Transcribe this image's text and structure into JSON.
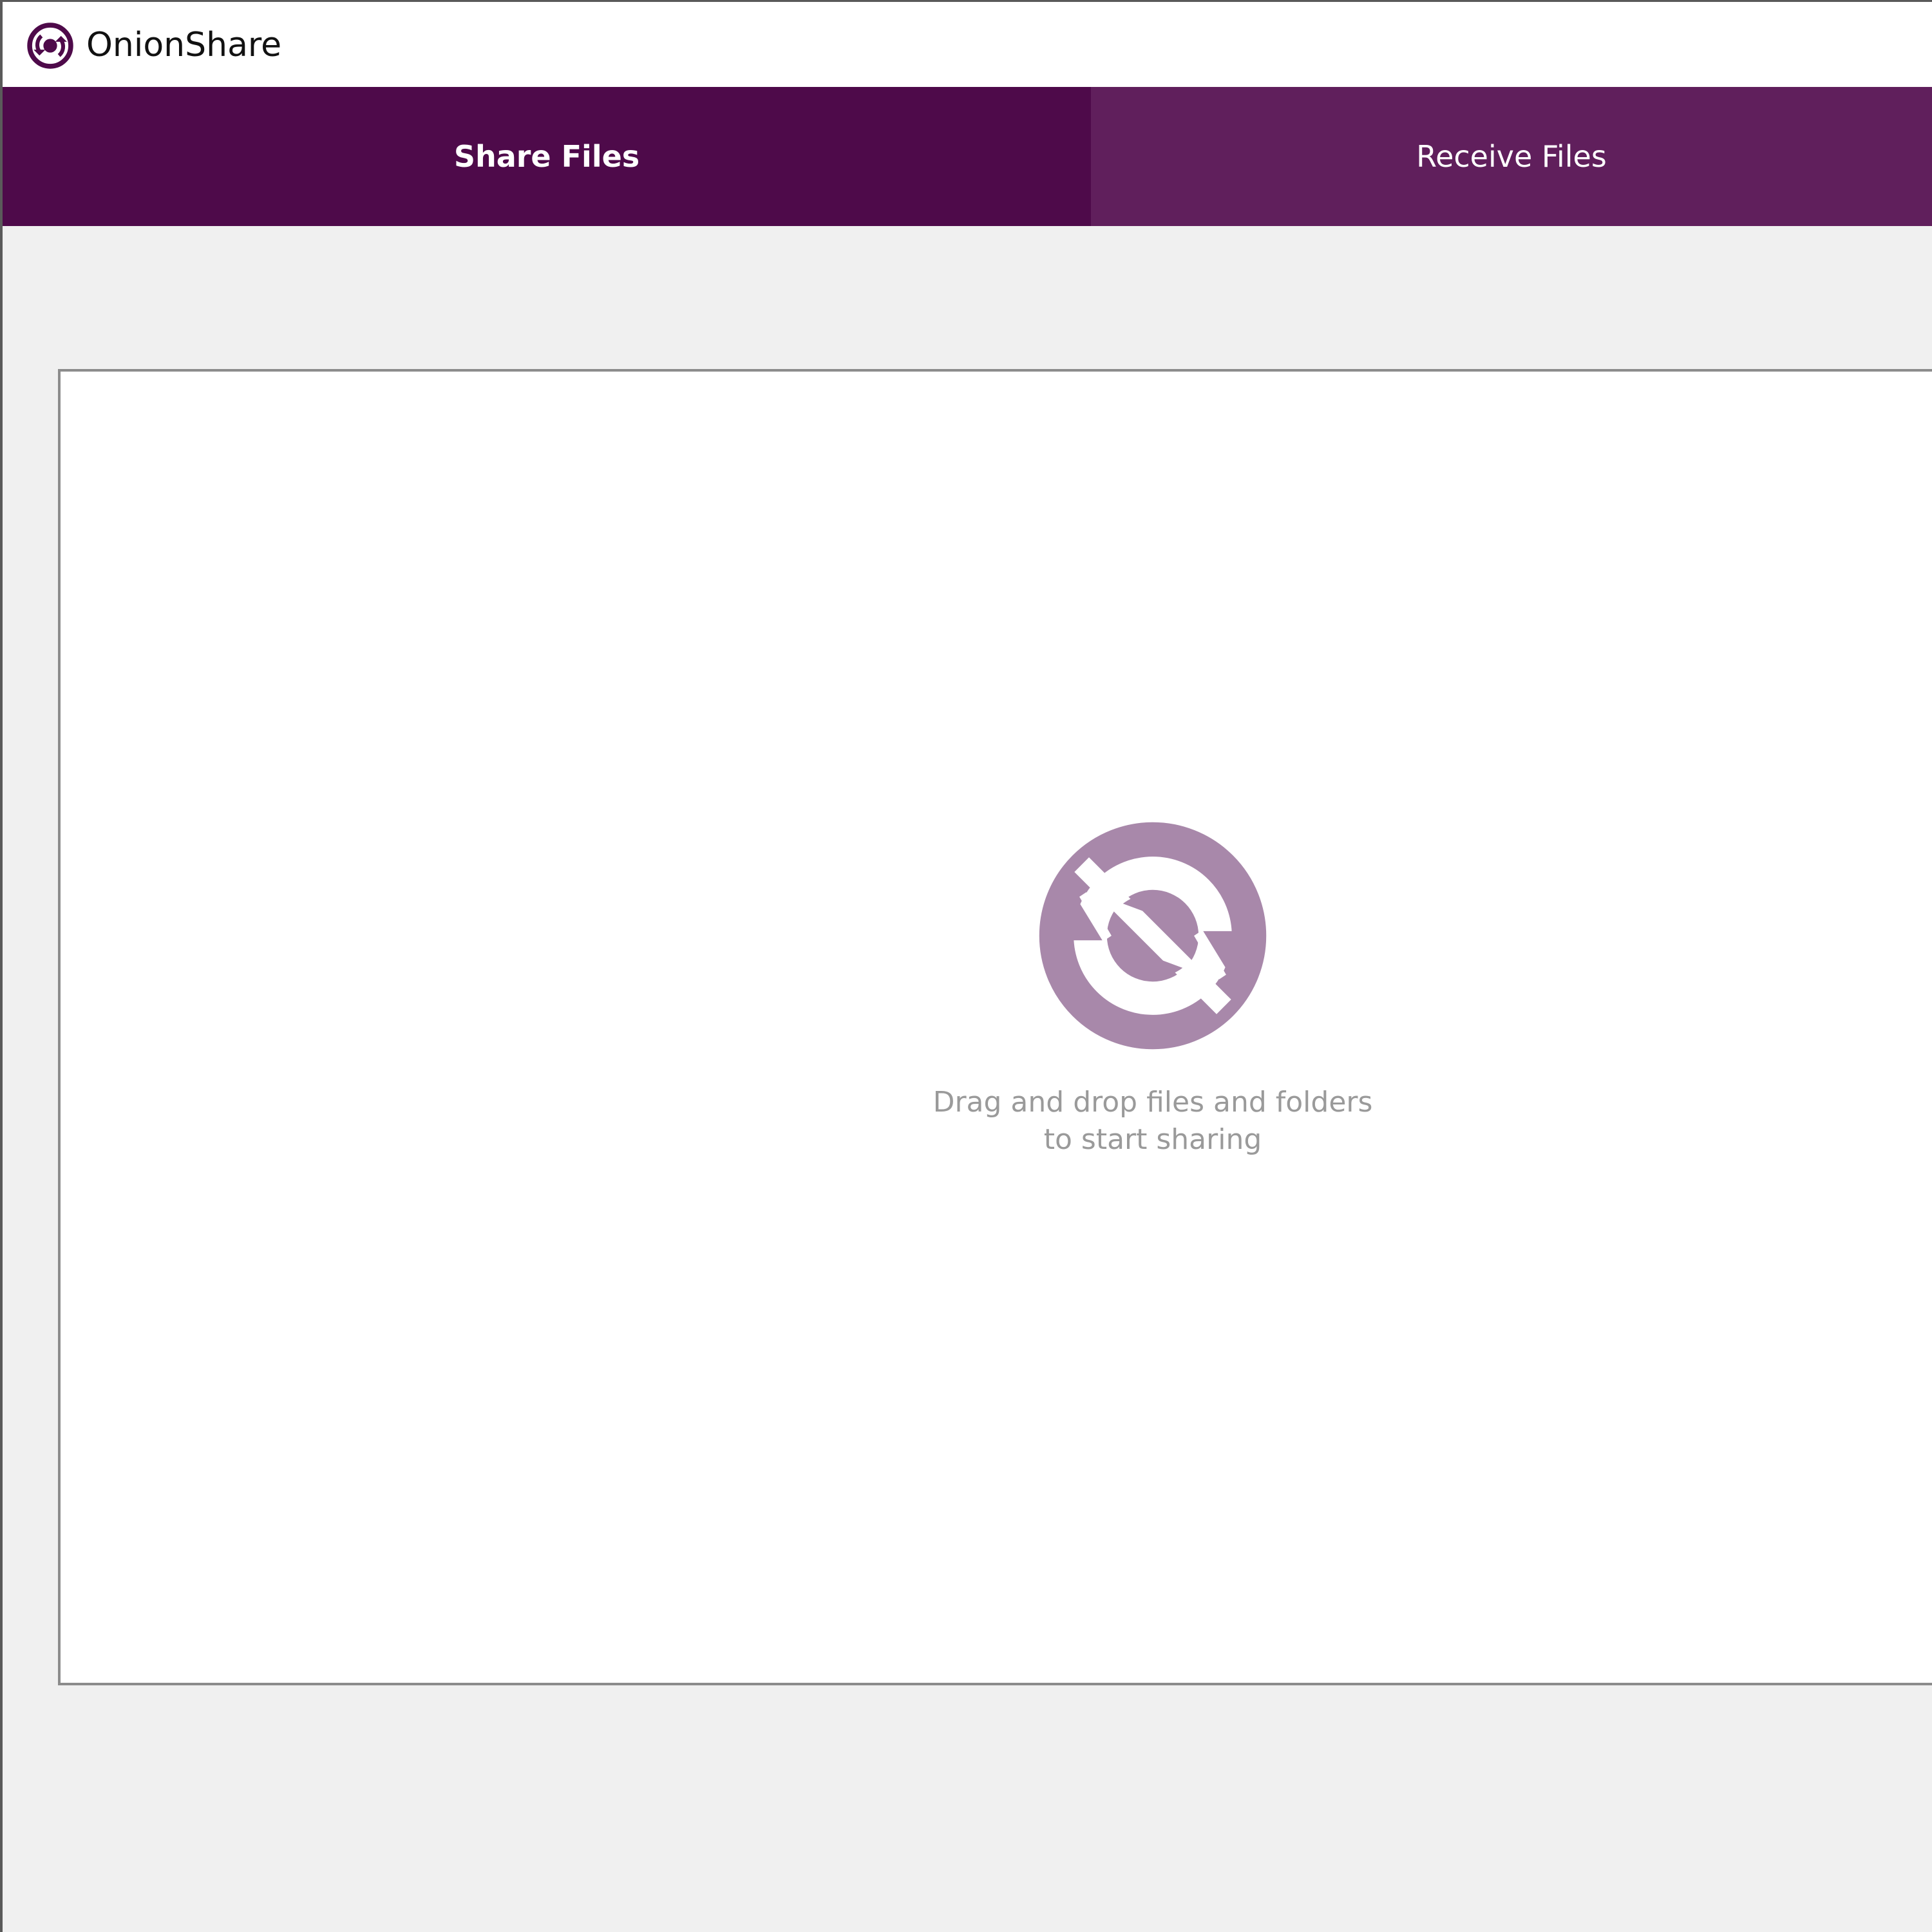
{
  "window": {
    "title": "OnionShare",
    "icon": "onionshare-logo-icon"
  },
  "tabs": [
    {
      "label": "Share Files",
      "active": true
    },
    {
      "label": "Receive Files",
      "active": false
    }
  ],
  "drop_zone": {
    "icon": "onionshare-logo-icon",
    "text_line1": "Drag and drop files and folders",
    "text_line2": "to start sharing"
  },
  "colors": {
    "active_tab": "#4e0a4a",
    "inactive_tab": "#601f5c",
    "drop_icon": "#a888aa",
    "title_icon": "#4e0a4a"
  }
}
